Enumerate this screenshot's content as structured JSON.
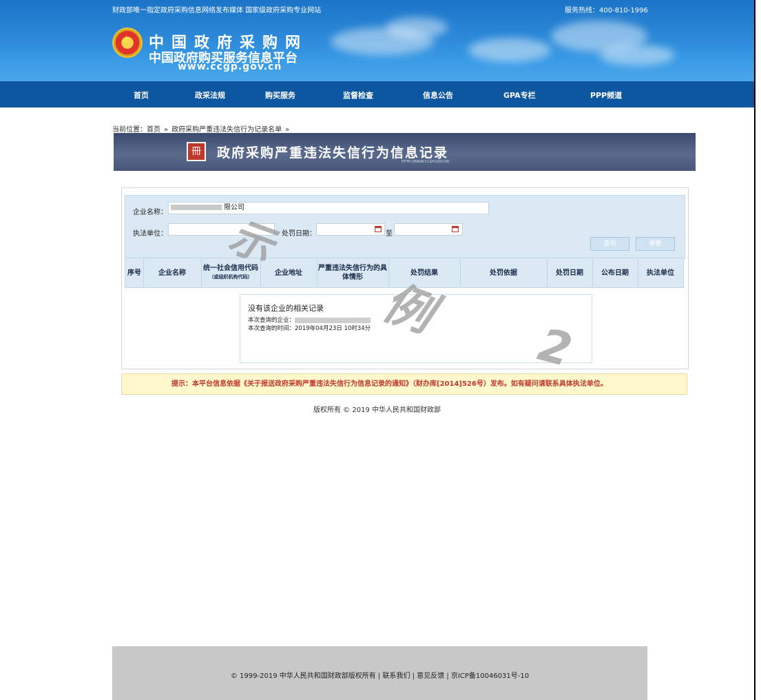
{
  "header": {
    "top_left": "财政部唯一指定政府采购信息网络发布媒体 国家级政府采购专业网站",
    "top_right": "服务热线：400-810-1996",
    "brand_line1": "中国政府采购网",
    "brand_line2": "中国政府购买服务信息平台",
    "brand_url": "www.ccgp.gov.cn"
  },
  "nav": {
    "items": [
      "首页",
      "政采法规",
      "购买服务",
      "监督检查",
      "信息公告",
      "GPA专栏",
      "PPP频道"
    ]
  },
  "breadcrumb": {
    "prefix": "当前位置：",
    "home": "首页",
    "separator": "»",
    "current": "政府采购严重违法失信行为记录名单",
    "trailing": "»"
  },
  "banner": {
    "icon_glyph": "冊",
    "title": "政府采购严重违法失信行为信息记录",
    "url": "HTTP://WWW.CCGP.GOV.CN/"
  },
  "search": {
    "company_label": "企业名称：",
    "company_value_visible": "限公司",
    "agency_label": "执法单位：",
    "agency_value": "",
    "date_label": "处罚日期：",
    "date_from": "",
    "to_label": "至",
    "date_to": "",
    "query_button": "查询",
    "reset_button": "重置"
  },
  "table": {
    "headers": [
      "序号",
      "企业名称",
      "统一社会信用代码",
      "企业地址",
      "严重违法失信行为的具体情形",
      "处罚结果",
      "处罚依据",
      "处罚日期",
      "公布日期",
      "执法单位"
    ],
    "credit_code_note": "（或组织机构代码）"
  },
  "result": {
    "empty_message": "没有该企业的相关记录",
    "queried_company_label": "本次查询的企业：",
    "queried_time_label": "本次查询的时间：",
    "queried_time_value": "2019年04月23日 10时34分"
  },
  "notice": {
    "text": "提示：本平台信息依据《关于报送政府采购严重违法失信行为信息记录的通知》（财办库[2014]526号）发布。如有疑问请联系具体执法单位。"
  },
  "copyright": "版权所有 © 2019 中华人民共和国财政部",
  "footer": {
    "text": "© 1999-2019  中华人民共和国财政部版权所有 | 联系我们 | 意见反馈 | 京ICP备10046031号-10"
  },
  "watermark": {
    "char1": "示",
    "char2": "例",
    "char3": "2"
  }
}
